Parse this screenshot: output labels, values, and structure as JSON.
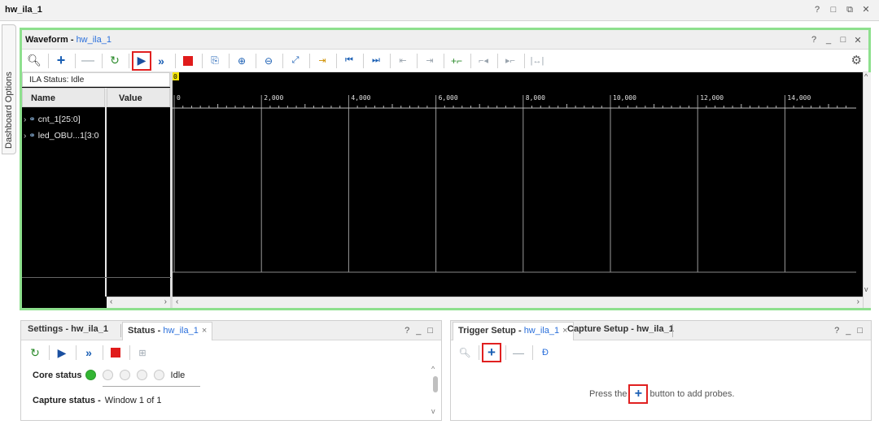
{
  "window": {
    "title": "hw_ila_1",
    "controls": [
      "?",
      "□",
      "⧉",
      "✕"
    ]
  },
  "side_tab": {
    "label": "Dashboard Options"
  },
  "waveform": {
    "title": "Waveform",
    "title_link": "hw_ila_1",
    "controls": [
      "?",
      "_",
      "□",
      "✕"
    ],
    "ila_status": "ILA Status: Idle",
    "col_name": "Name",
    "col_value": "Value",
    "signals": [
      {
        "name": "cnt_1[25:0]"
      },
      {
        "name": "led_OBU...1[3:0"
      }
    ],
    "marker": "0",
    "ticks": [
      "0",
      "2,000",
      "4,000",
      "6,000",
      "8,000",
      "10,000",
      "12,000",
      "14,000"
    ],
    "colors": {
      "boxed_outline": "#e02020",
      "panel_border": "#8ee08e"
    }
  },
  "toolbar_icons": [
    "search-icon",
    "plus-icon",
    "minus-icon",
    "auto-refresh-icon",
    "run-trigger-icon",
    "run-immediate-icon",
    "stop-icon",
    "export-icon",
    "zoom-in-icon",
    "zoom-out-icon",
    "zoom-fit-icon",
    "goto-cursor-icon",
    "goto-start-icon",
    "goto-end-icon",
    "prev-transition-icon",
    "next-transition-icon",
    "add-marker-icon",
    "prev-marker-icon",
    "next-marker-icon",
    "swap-cursors-icon",
    "gear-icon"
  ],
  "status_panel": {
    "tab_settings": "Settings - hw_ila_1",
    "tab_status": "Status",
    "tab_status_link": "hw_ila_1",
    "controls": [
      "?",
      "_",
      "□"
    ],
    "core_status_label": "Core status",
    "core_status_value": "Idle",
    "capture_status_label": "Capture status -",
    "capture_status_value": "Window 1 of 1"
  },
  "trigger_panel": {
    "tab_trigger": "Trigger Setup",
    "tab_trigger_link": "hw_ila_1",
    "tab_capture": "Capture Setup - hw_ila_1",
    "controls": [
      "?",
      "_",
      "□"
    ],
    "hint_before": "Press the",
    "hint_after": "button to add probes."
  }
}
